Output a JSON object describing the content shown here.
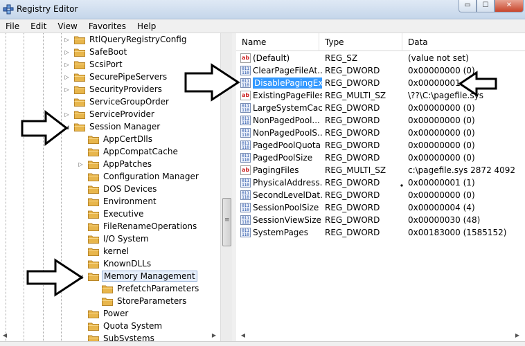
{
  "window": {
    "title": "Registry Editor",
    "minimize_glyph": "▭",
    "maximize_glyph": "☐",
    "close_glyph": "✕"
  },
  "menu": [
    "File",
    "Edit",
    "View",
    "Favorites",
    "Help"
  ],
  "tree": {
    "items": [
      {
        "label": "RtlQueryRegistryConfig",
        "expander": "collapsed",
        "selected": false
      },
      {
        "label": "SafeBoot",
        "expander": "collapsed",
        "selected": false
      },
      {
        "label": "ScsiPort",
        "expander": "collapsed",
        "selected": false
      },
      {
        "label": "SecurePipeServers",
        "expander": "collapsed",
        "selected": false
      },
      {
        "label": "SecurityProviders",
        "expander": "collapsed",
        "selected": false
      },
      {
        "label": "ServiceGroupOrder",
        "expander": "none",
        "selected": false
      },
      {
        "label": "ServiceProvider",
        "expander": "collapsed",
        "selected": false
      },
      {
        "label": "Session Manager",
        "expander": "expanded",
        "selected": false
      },
      {
        "label": "AppCertDlls",
        "expander": "none",
        "selected": false
      },
      {
        "label": "AppCompatCache",
        "expander": "none",
        "selected": false
      },
      {
        "label": "AppPatches",
        "expander": "collapsed",
        "selected": false
      },
      {
        "label": "Configuration Manager",
        "expander": "none",
        "selected": false
      },
      {
        "label": "DOS Devices",
        "expander": "none",
        "selected": false
      },
      {
        "label": "Environment",
        "expander": "none",
        "selected": false
      },
      {
        "label": "Executive",
        "expander": "none",
        "selected": false
      },
      {
        "label": "FileRenameOperations",
        "expander": "none",
        "selected": false
      },
      {
        "label": "I/O System",
        "expander": "none",
        "selected": false
      },
      {
        "label": "kernel",
        "expander": "none",
        "selected": false
      },
      {
        "label": "KnownDLLs",
        "expander": "none",
        "selected": false
      },
      {
        "label": "Memory Management",
        "expander": "expanded",
        "selected": true
      },
      {
        "label": "PrefetchParameters",
        "expander": "none",
        "selected": false
      },
      {
        "label": "StoreParameters",
        "expander": "none",
        "selected": false
      },
      {
        "label": "Power",
        "expander": "none",
        "selected": false
      },
      {
        "label": "Quota System",
        "expander": "none",
        "selected": false
      },
      {
        "label": "SubSystems",
        "expander": "none",
        "selected": false
      }
    ]
  },
  "list": {
    "columns": [
      "Name",
      "Type",
      "Data"
    ],
    "rows": [
      {
        "name": "(Default)",
        "type": "REG_SZ",
        "data": "(value not set)",
        "icon": "string-value-icon",
        "selected": false
      },
      {
        "name": "ClearPageFileAt...",
        "type": "REG_DWORD",
        "data": "0x00000000 (0)",
        "icon": "binary-value-icon",
        "selected": false
      },
      {
        "name": "DisablePagingEx...",
        "type": "REG_DWORD",
        "data": "0x00000001 (1)",
        "icon": "binary-value-icon",
        "selected": true
      },
      {
        "name": "ExistingPageFiles",
        "type": "REG_MULTI_SZ",
        "data": "\\??\\C:\\pagefile.sys",
        "icon": "string-value-icon",
        "selected": false
      },
      {
        "name": "LargeSystemCac...",
        "type": "REG_DWORD",
        "data": "0x00000000 (0)",
        "icon": "binary-value-icon",
        "selected": false
      },
      {
        "name": "NonPagedPool...",
        "type": "REG_DWORD",
        "data": "0x00000000 (0)",
        "icon": "binary-value-icon",
        "selected": false
      },
      {
        "name": "NonPagedPoolS...",
        "type": "REG_DWORD",
        "data": "0x00000000 (0)",
        "icon": "binary-value-icon",
        "selected": false
      },
      {
        "name": "PagedPoolQuota",
        "type": "REG_DWORD",
        "data": "0x00000000 (0)",
        "icon": "binary-value-icon",
        "selected": false
      },
      {
        "name": "PagedPoolSize",
        "type": "REG_DWORD",
        "data": "0x00000000 (0)",
        "icon": "binary-value-icon",
        "selected": false
      },
      {
        "name": "PagingFiles",
        "type": "REG_MULTI_SZ",
        "data": "c:\\pagefile.sys 2872 4092",
        "icon": "string-value-icon",
        "selected": false
      },
      {
        "name": "PhysicalAddress...",
        "type": "REG_DWORD",
        "data": "0x00000001 (1)",
        "icon": "binary-value-icon",
        "selected": false
      },
      {
        "name": "SecondLevelDat...",
        "type": "REG_DWORD",
        "data": "0x00000000 (0)",
        "icon": "binary-value-icon",
        "selected": false
      },
      {
        "name": "SessionPoolSize",
        "type": "REG_DWORD",
        "data": "0x00000004 (4)",
        "icon": "binary-value-icon",
        "selected": false
      },
      {
        "name": "SessionViewSize",
        "type": "REG_DWORD",
        "data": "0x00000030 (48)",
        "icon": "binary-value-icon",
        "selected": false
      },
      {
        "name": "SystemPages",
        "type": "REG_DWORD",
        "data": "0x00183000 (1585152)",
        "icon": "binary-value-icon",
        "selected": false
      }
    ]
  },
  "icons": {
    "string_glyph": "ab",
    "binary_glyph": "011\n110",
    "expand_collapsed": "▷",
    "expand_expanded": "◢",
    "scroll_left": "◀",
    "scroll_right": "▶"
  },
  "colors": {
    "selection": "#3399ff",
    "folder": "#e8b64c",
    "annotation_arrow": "#000000"
  }
}
